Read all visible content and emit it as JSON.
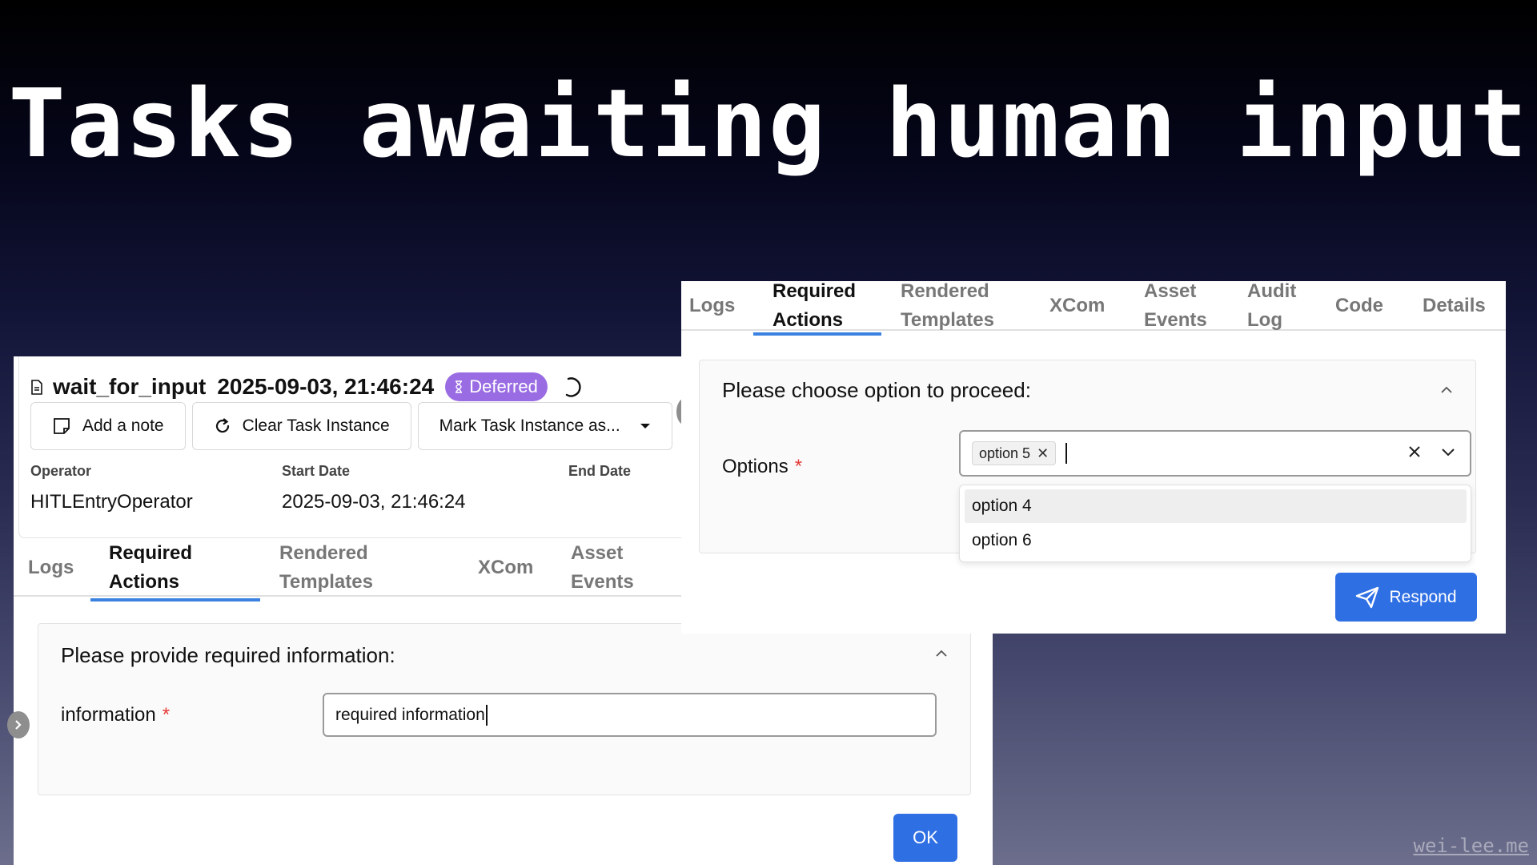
{
  "slide": {
    "title": "Tasks awaiting human input",
    "watermark": "wei-lee.me"
  },
  "task": {
    "name": "wait_for_input",
    "date": "2025-09-03, 21:46:24",
    "status": "Deferred",
    "status_color": "#9a6ce3",
    "buttons": {
      "add_note": "Add a note",
      "clear": "Clear Task Instance",
      "mark": "Mark Task Instance as..."
    },
    "meta": {
      "operator_label": "Operator",
      "operator_value": "HITLEntryOperator",
      "start_label": "Start Date",
      "start_value": "2025-09-03, 21:46:24",
      "end_label": "End Date"
    }
  },
  "left_tabs": [
    {
      "line1": "Logs",
      "line2": ""
    },
    {
      "line1": "Required",
      "line2": "Actions"
    },
    {
      "line1": "Rendered",
      "line2": "Templates"
    },
    {
      "line1": "XCom",
      "line2": ""
    },
    {
      "line1": "Asset",
      "line2": "Events"
    }
  ],
  "info_form": {
    "title": "Please provide required information:",
    "field_label": "information",
    "required_mark": "*",
    "field_value": "required information",
    "submit": "OK"
  },
  "right_tabs": [
    {
      "line1": "Logs",
      "line2": ""
    },
    {
      "line1": "Required",
      "line2": "Actions"
    },
    {
      "line1": "Rendered",
      "line2": "Templates"
    },
    {
      "line1": "XCom",
      "line2": ""
    },
    {
      "line1": "Asset",
      "line2": "Events"
    },
    {
      "line1": "Audit",
      "line2": "Log"
    },
    {
      "line1": "Code",
      "line2": ""
    },
    {
      "line1": "Details",
      "line2": ""
    }
  ],
  "choose_form": {
    "title": "Please choose option to proceed:",
    "field_label": "Options",
    "required_mark": "*",
    "selected_chip": "option 5",
    "dropdown_options": [
      "option 4",
      "option 6"
    ],
    "submit": "Respond"
  },
  "colors": {
    "accent": "#2f6fe4",
    "active_tab_underline": "#3b82e0",
    "required": "#e53935"
  },
  "icons": [
    "doc-icon",
    "hourglass-icon",
    "spinner-icon",
    "note-icon",
    "refresh-icon",
    "chevron-down-icon",
    "chevron-up-icon",
    "close-icon",
    "send-icon",
    "chevron-right-icon"
  ]
}
